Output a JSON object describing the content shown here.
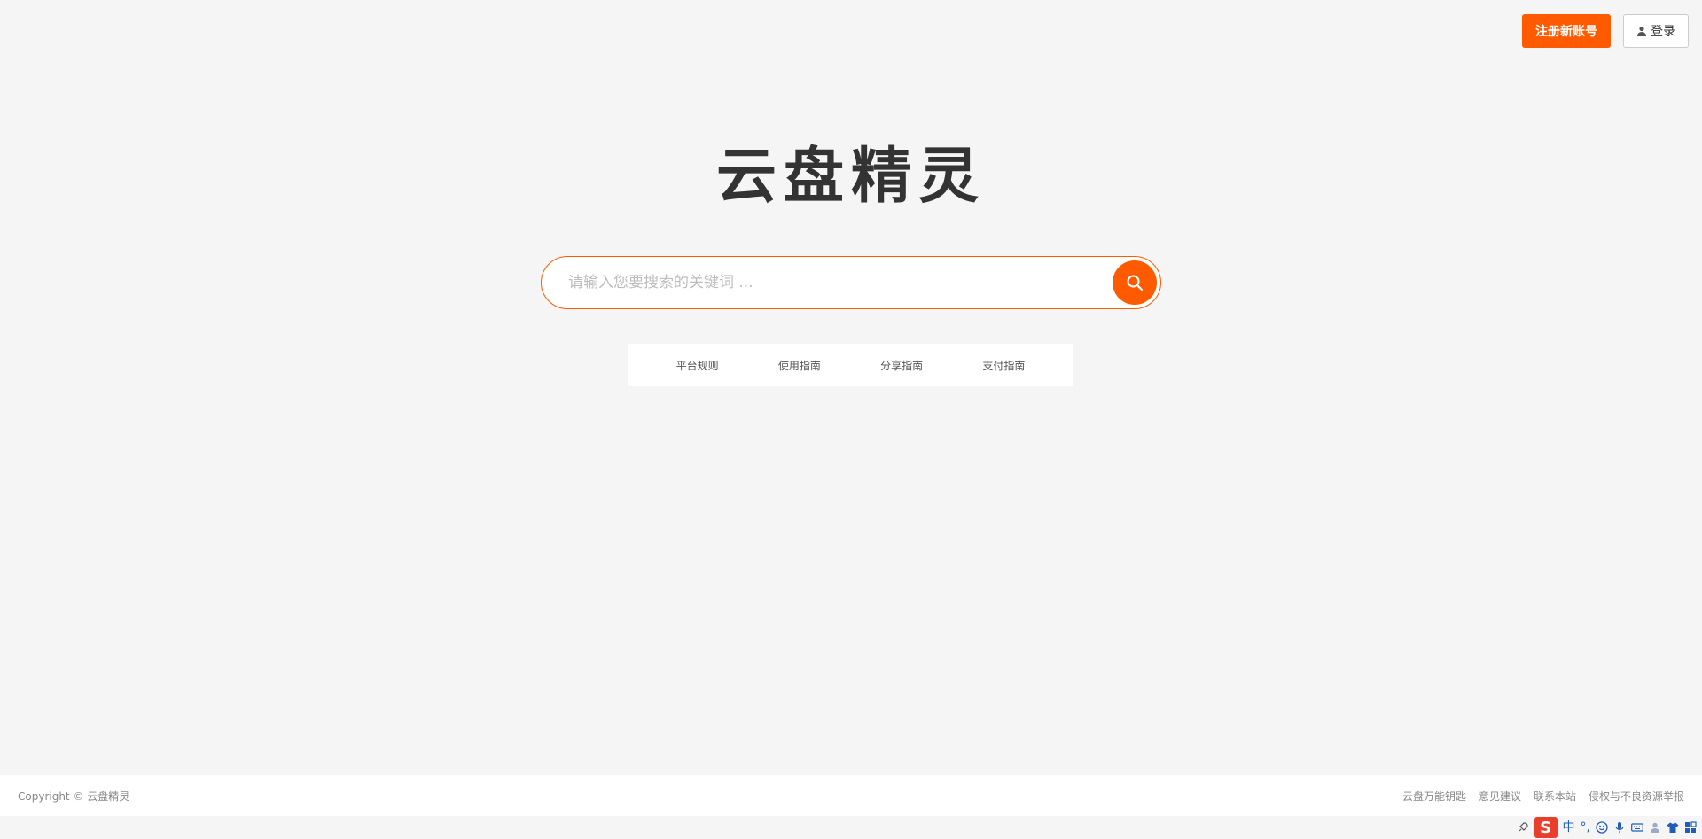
{
  "header": {
    "register_label": "注册新账号",
    "login_label": "登录"
  },
  "logo": {
    "text": "云盘精灵"
  },
  "search": {
    "placeholder": "请输入您要搜索的关键词 ..."
  },
  "nav": {
    "items": [
      {
        "label": "平台规则"
      },
      {
        "label": "使用指南"
      },
      {
        "label": "分享指南"
      },
      {
        "label": "支付指南"
      }
    ]
  },
  "footer": {
    "copyright": "Copyright © 云盘精灵",
    "links": [
      {
        "label": "云盘万能钥匙"
      },
      {
        "label": "意见建议"
      },
      {
        "label": "联系本站"
      },
      {
        "label": "侵权与不良资源举报"
      }
    ]
  },
  "ime": {
    "logo": "S",
    "mode": "中",
    "punct": "°,"
  },
  "colors": {
    "accent": "#ff5a00",
    "background": "#f5f5f5"
  }
}
